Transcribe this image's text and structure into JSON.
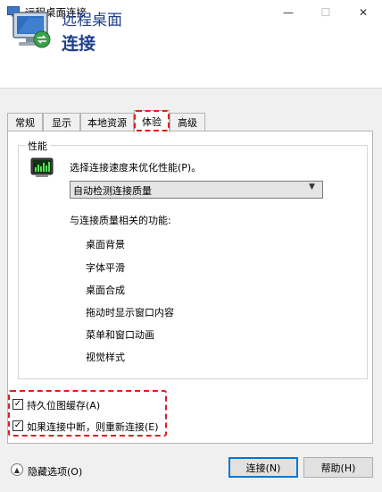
{
  "window": {
    "title": "远程桌面连接",
    "controls": {
      "minimize": "—",
      "maximize": "☐",
      "close": "✕"
    }
  },
  "header": {
    "line1": "远程桌面",
    "line2": "连接"
  },
  "tabs": [
    {
      "label": "常规",
      "active": false
    },
    {
      "label": "显示",
      "active": false
    },
    {
      "label": "本地资源",
      "active": false
    },
    {
      "label": "体验",
      "active": true
    },
    {
      "label": "高级",
      "active": false
    }
  ],
  "performance": {
    "group_label": "性能",
    "select_label": "选择连接速度来优化性能(P)。",
    "selected_value": "自动检测连接质量",
    "features_heading": "与连接质量相关的功能:",
    "features": [
      "桌面背景",
      "字体平滑",
      "桌面合成",
      "拖动时显示窗口内容",
      "菜单和窗口动画",
      "视觉样式"
    ]
  },
  "checkboxes": [
    {
      "label": "持久位图缓存(A)",
      "checked": true
    },
    {
      "label": "如果连接中断，则重新连接(E)",
      "checked": true
    }
  ],
  "footer": {
    "options_label": "隐藏选项(O)",
    "connect_label": "连接(N)",
    "help_label": "帮助(H)"
  },
  "colors": {
    "highlight": "#e11d1d",
    "header_text": "#1f3f8a",
    "default_button": "#0078d7"
  }
}
